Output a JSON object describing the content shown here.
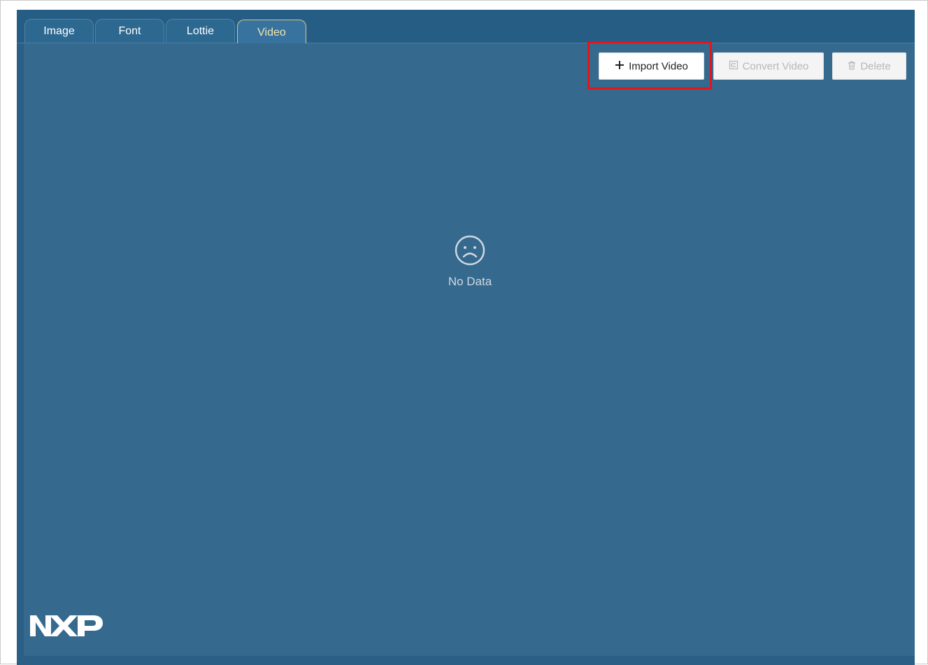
{
  "tabs": [
    {
      "label": "Image",
      "active": false
    },
    {
      "label": "Font",
      "active": false
    },
    {
      "label": "Lottie",
      "active": false
    },
    {
      "label": "Video",
      "active": true
    }
  ],
  "toolbar": {
    "import_label": "Import Video",
    "convert_label": "Convert Video",
    "delete_label": "Delete",
    "import_icon": "plus-icon",
    "convert_icon": "convert-icon",
    "delete_icon": "trash-icon"
  },
  "empty_state": {
    "icon": "sad-face-icon",
    "text": "No Data"
  },
  "brand": {
    "logo": "NXP"
  },
  "colors": {
    "background": "#35698e",
    "tabstrip": "#255d84",
    "active_tab_text": "#f2e6b0",
    "highlight": "#e3151a"
  }
}
